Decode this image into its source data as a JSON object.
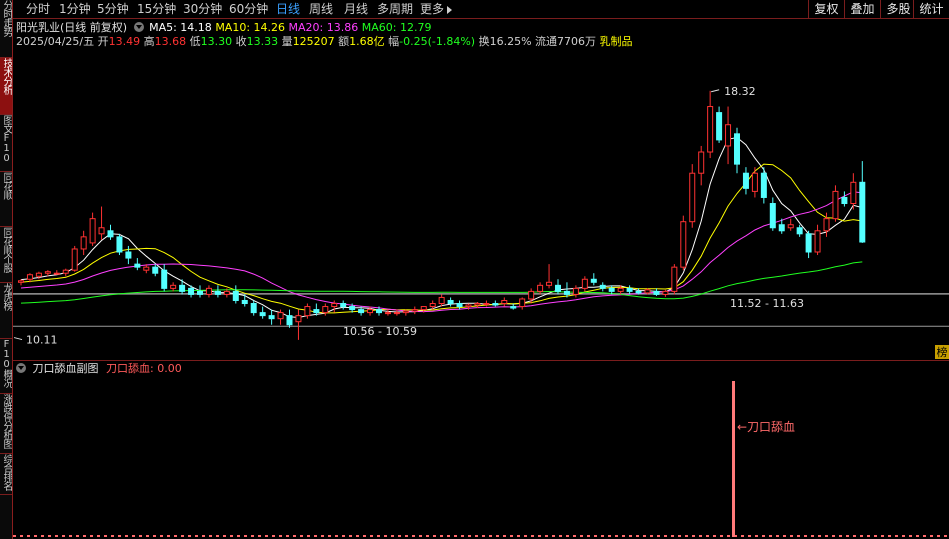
{
  "side_tabs": [
    {
      "label": "分时走势",
      "active": false
    },
    {
      "label": "技术分析",
      "active": true
    },
    {
      "label": "图文F10",
      "active": false
    },
    {
      "label": "同花顺F10",
      "active": false
    },
    {
      "label": "同花顺个股",
      "active": false
    },
    {
      "label": "龙虎榜",
      "active": false
    },
    {
      "label": "F10概况",
      "active": false
    },
    {
      "label": "涨跌停分析图",
      "active": false
    },
    {
      "label": "综合排名",
      "active": false
    }
  ],
  "periods": [
    "分时",
    "1分钟",
    "5分钟",
    "15分钟",
    "30分钟",
    "60分钟",
    "日线",
    "周线",
    "月线",
    "多周期",
    "更多"
  ],
  "active_period": "日线",
  "right_buttons": [
    "复权",
    "叠加",
    "多股",
    "统计"
  ],
  "stock": {
    "title": "阳光乳业(日线 前复权)",
    "ma5": "MA5: 14.18",
    "ma10": "MA10: 14.26",
    "ma20": "MA20: 13.86",
    "ma60": "MA60: 12.79",
    "date": "2025/04/25/五",
    "open_label": "开",
    "open": "13.49",
    "high_label": "高",
    "high": "13.68",
    "low_label": "低",
    "low": "13.30",
    "close_label": "收",
    "close": "13.33",
    "vol_label": "量",
    "vol": "125207",
    "amt_label": "额",
    "amt": "1.68亿",
    "chg_label": "幅",
    "chg": "-0.25(-1.84%)",
    "turn": "换16.25%",
    "float": "流通7706万",
    "industry": "乳制品"
  },
  "annotations": {
    "high": "18.32",
    "low": "10.11",
    "range1": "10.56 - 10.59",
    "range2": "11.52 - 11.63",
    "bang": "榜"
  },
  "indicator": {
    "name": "刀口舔血副图",
    "value_label": "刀口舔血: 0.00",
    "signal": "←刀口舔血"
  },
  "colors": {
    "up": "#ff3232",
    "down": "#54ffff",
    "ma5": "#ffffff",
    "ma10": "#ffff00",
    "ma20": "#ff40ff",
    "ma60": "#20ff20",
    "accent": "#8c1010"
  },
  "chart_data": {
    "type": "candlestick",
    "note": "Daily OHLC (approximate, front-adjusted) read from price axis",
    "candles": [
      [
        12.0,
        12.1,
        11.9,
        12.05
      ],
      [
        12.1,
        12.3,
        12.0,
        12.25
      ],
      [
        12.2,
        12.35,
        12.1,
        12.3
      ],
      [
        12.3,
        12.4,
        12.2,
        12.35
      ],
      [
        12.3,
        12.4,
        12.25,
        12.3
      ],
      [
        12.3,
        12.45,
        12.2,
        12.4
      ],
      [
        12.4,
        13.2,
        12.35,
        13.1
      ],
      [
        13.1,
        13.7,
        12.9,
        13.5
      ],
      [
        13.3,
        14.3,
        13.2,
        14.1
      ],
      [
        13.6,
        14.5,
        13.4,
        13.8
      ],
      [
        13.7,
        13.9,
        13.4,
        13.5
      ],
      [
        13.5,
        13.6,
        12.9,
        13.0
      ],
      [
        13.0,
        13.2,
        12.6,
        12.8
      ],
      [
        12.6,
        12.8,
        12.4,
        12.5
      ],
      [
        12.4,
        12.6,
        12.3,
        12.5
      ],
      [
        12.5,
        12.6,
        12.2,
        12.3
      ],
      [
        12.4,
        12.6,
        11.7,
        11.8
      ],
      [
        11.8,
        12.0,
        11.7,
        11.9
      ],
      [
        11.9,
        12.1,
        11.6,
        11.7
      ],
      [
        11.8,
        11.9,
        11.5,
        11.6
      ],
      [
        11.7,
        11.9,
        11.5,
        11.6
      ],
      [
        11.6,
        11.9,
        11.5,
        11.8
      ],
      [
        11.7,
        11.9,
        11.5,
        11.6
      ],
      [
        11.6,
        11.8,
        11.5,
        11.7
      ],
      [
        11.7,
        11.9,
        11.3,
        11.4
      ],
      [
        11.4,
        11.6,
        11.2,
        11.3
      ],
      [
        11.3,
        11.4,
        10.9,
        11.0
      ],
      [
        11.0,
        11.2,
        10.8,
        10.9
      ],
      [
        10.9,
        11.1,
        10.6,
        10.8
      ],
      [
        10.8,
        11.1,
        10.6,
        11.0
      ],
      [
        10.9,
        11.1,
        10.5,
        10.6
      ],
      [
        10.7,
        11.1,
        10.1,
        10.9
      ],
      [
        10.9,
        11.3,
        10.8,
        11.2
      ],
      [
        11.1,
        11.3,
        10.9,
        11.0
      ],
      [
        11.0,
        11.3,
        10.9,
        11.2
      ],
      [
        11.2,
        11.4,
        11.0,
        11.3
      ],
      [
        11.3,
        11.4,
        11.1,
        11.2
      ],
      [
        11.2,
        11.3,
        11.0,
        11.1
      ],
      [
        11.1,
        11.2,
        10.9,
        11.0
      ],
      [
        11.0,
        11.2,
        10.9,
        11.1
      ],
      [
        11.1,
        11.2,
        10.9,
        11.0
      ],
      [
        11.0,
        11.1,
        10.9,
        11.0
      ],
      [
        11.0,
        11.1,
        10.9,
        11.0
      ],
      [
        11.0,
        11.1,
        10.9,
        11.05
      ],
      [
        11.05,
        11.2,
        10.95,
        11.1
      ],
      [
        11.1,
        11.2,
        11.0,
        11.2
      ],
      [
        11.2,
        11.4,
        11.1,
        11.3
      ],
      [
        11.3,
        11.6,
        11.2,
        11.5
      ],
      [
        11.4,
        11.5,
        11.2,
        11.3
      ],
      [
        11.3,
        11.4,
        11.1,
        11.2
      ],
      [
        11.2,
        11.3,
        11.1,
        11.25
      ],
      [
        11.25,
        11.35,
        11.15,
        11.3
      ],
      [
        11.3,
        11.4,
        11.2,
        11.3
      ],
      [
        11.3,
        11.4,
        11.2,
        11.25
      ],
      [
        11.3,
        11.5,
        11.2,
        11.4
      ],
      [
        11.2,
        11.3,
        11.1,
        11.15
      ],
      [
        11.2,
        11.5,
        11.1,
        11.45
      ],
      [
        11.45,
        11.8,
        11.3,
        11.7
      ],
      [
        11.7,
        12.0,
        11.6,
        11.9
      ],
      [
        11.9,
        12.6,
        11.8,
        12.0
      ],
      [
        11.9,
        12.1,
        11.6,
        11.7
      ],
      [
        11.7,
        12.0,
        11.5,
        11.6
      ],
      [
        11.6,
        11.9,
        11.5,
        11.8
      ],
      [
        11.8,
        12.2,
        11.7,
        12.1
      ],
      [
        12.1,
        12.3,
        11.9,
        12.0
      ],
      [
        11.9,
        12.0,
        11.7,
        11.8
      ],
      [
        11.8,
        11.9,
        11.6,
        11.7
      ],
      [
        11.7,
        11.9,
        11.6,
        11.8
      ],
      [
        11.8,
        11.9,
        11.6,
        11.7
      ],
      [
        11.7,
        11.8,
        11.6,
        11.65
      ],
      [
        11.65,
        11.8,
        11.6,
        11.75
      ],
      [
        11.7,
        11.8,
        11.55,
        11.6
      ],
      [
        11.6,
        11.75,
        11.52,
        11.7
      ],
      [
        11.7,
        12.6,
        11.6,
        12.5
      ],
      [
        12.5,
        14.2,
        12.4,
        14.0
      ],
      [
        14.0,
        15.9,
        13.8,
        15.6
      ],
      [
        15.6,
        16.5,
        15.2,
        16.3
      ],
      [
        16.3,
        18.32,
        16.1,
        17.8
      ],
      [
        17.6,
        17.8,
        16.6,
        16.7
      ],
      [
        16.5,
        17.8,
        15.9,
        17.2
      ],
      [
        16.9,
        17.1,
        15.6,
        15.9
      ],
      [
        15.6,
        15.8,
        14.9,
        15.1
      ],
      [
        15.0,
        15.8,
        14.8,
        15.6
      ],
      [
        15.6,
        15.8,
        14.6,
        14.8
      ],
      [
        14.6,
        14.8,
        13.7,
        13.8
      ],
      [
        13.9,
        14.1,
        13.6,
        13.7
      ],
      [
        13.8,
        14.1,
        13.7,
        13.9
      ],
      [
        13.8,
        13.9,
        13.5,
        13.6
      ],
      [
        13.6,
        13.7,
        12.8,
        13.0
      ],
      [
        13.0,
        13.9,
        12.9,
        13.7
      ],
      [
        13.7,
        14.3,
        13.5,
        14.1
      ],
      [
        14.1,
        15.2,
        14.0,
        15.0
      ],
      [
        14.8,
        15.0,
        14.5,
        14.6
      ],
      [
        14.6,
        15.6,
        14.4,
        15.3
      ],
      [
        15.3,
        16.0,
        13.3,
        13.33
      ]
    ],
    "marks": {
      "high": 18.32,
      "low": 10.11
    },
    "yrange": [
      9.7,
      19.6
    ]
  }
}
